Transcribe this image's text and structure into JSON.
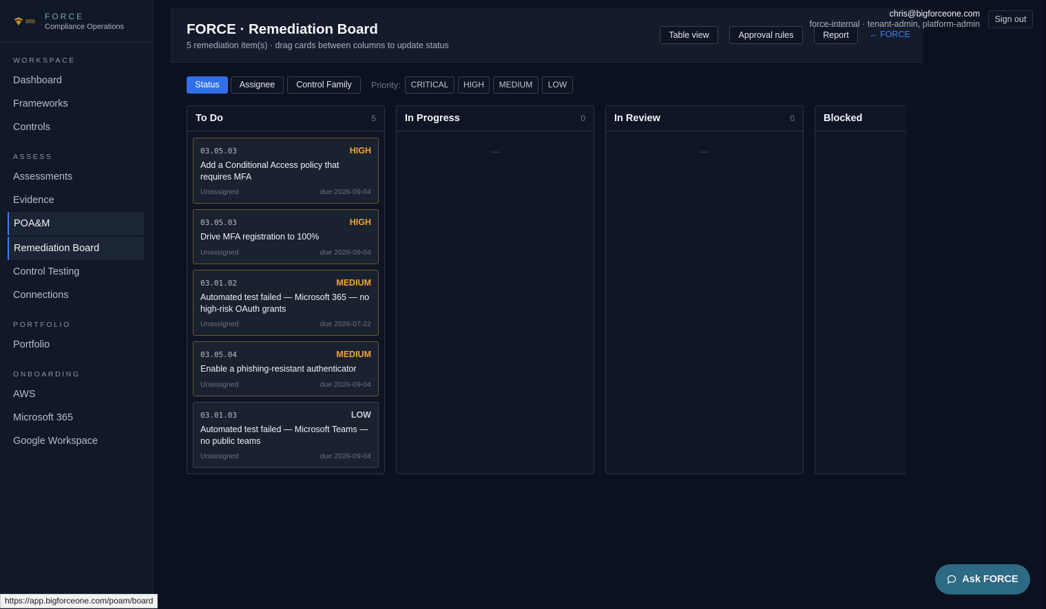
{
  "brand": {
    "name": "FORCE",
    "subtitle": "Compliance Operations"
  },
  "sidebar": {
    "sections": [
      {
        "title": "WORKSPACE",
        "items": [
          "Dashboard",
          "Frameworks",
          "Controls"
        ]
      },
      {
        "title": "ASSESS",
        "items": [
          "Assessments",
          "Evidence",
          "POA&M",
          "Remediation Board",
          "Control Testing",
          "Connections"
        ]
      },
      {
        "title": "PORTFOLIO",
        "items": [
          "Portfolio"
        ]
      },
      {
        "title": "ONBOARDING",
        "items": [
          "AWS",
          "Microsoft 365",
          "Google Workspace"
        ]
      }
    ],
    "active_items": [
      "POA&M",
      "Remediation Board"
    ]
  },
  "header": {
    "title": "FORCE · Remediation Board",
    "subtitle": "5 remediation item(s) · drag cards between columns to update status",
    "buttons": {
      "table_view": "Table view",
      "approval_rules": "Approval rules",
      "report": "Report"
    },
    "back_link": "← FORCE"
  },
  "user": {
    "email": "chris@bigforceone.com",
    "roles": "force-internal · tenant-admin, platform-admin",
    "sign_out": "Sign out"
  },
  "filters": {
    "group_by": [
      "Status",
      "Assignee",
      "Control Family"
    ],
    "active_group": "Status",
    "priority_label": "Priority:",
    "priorities": [
      "CRITICAL",
      "HIGH",
      "MEDIUM",
      "LOW"
    ]
  },
  "columns": [
    {
      "title": "To Do",
      "count": "5",
      "cards": [
        {
          "code": "03.05.03",
          "priority": "HIGH",
          "title": "Add a Conditional Access policy that requires MFA",
          "assignee": "Unassigned",
          "due": "due 2026-09-04"
        },
        {
          "code": "03.05.03",
          "priority": "HIGH",
          "title": "Drive MFA registration to 100%",
          "assignee": "Unassigned",
          "due": "due 2026-09-04"
        },
        {
          "code": "03.01.02",
          "priority": "MEDIUM",
          "title": "Automated test failed — Microsoft 365 — no high-risk OAuth grants",
          "assignee": "Unassigned",
          "due": "due 2026-07-22"
        },
        {
          "code": "03.05.04",
          "priority": "MEDIUM",
          "title": "Enable a phishing-resistant authenticator",
          "assignee": "Unassigned",
          "due": "due 2026-09-04"
        },
        {
          "code": "03.01.03",
          "priority": "LOW",
          "title": "Automated test failed — Microsoft Teams — no public teams",
          "assignee": "Unassigned",
          "due": "due 2026-09-04"
        }
      ]
    },
    {
      "title": "In Progress",
      "count": "0",
      "empty": "—"
    },
    {
      "title": "In Review",
      "count": "0",
      "empty": "—"
    },
    {
      "title": "Blocked",
      "count": ""
    }
  ],
  "assistant": {
    "label": "Ask FORCE"
  },
  "status_url": "https://app.bigforceone.com/poam/board",
  "colors": {
    "accent": "#2f6fe8",
    "priority_high": "#f2a33a",
    "background": "#0c1120",
    "assistant": "#2d6a83"
  },
  "icons": [
    "force-logo-icon",
    "arrow-left-icon",
    "chat-bubble-icon"
  ]
}
